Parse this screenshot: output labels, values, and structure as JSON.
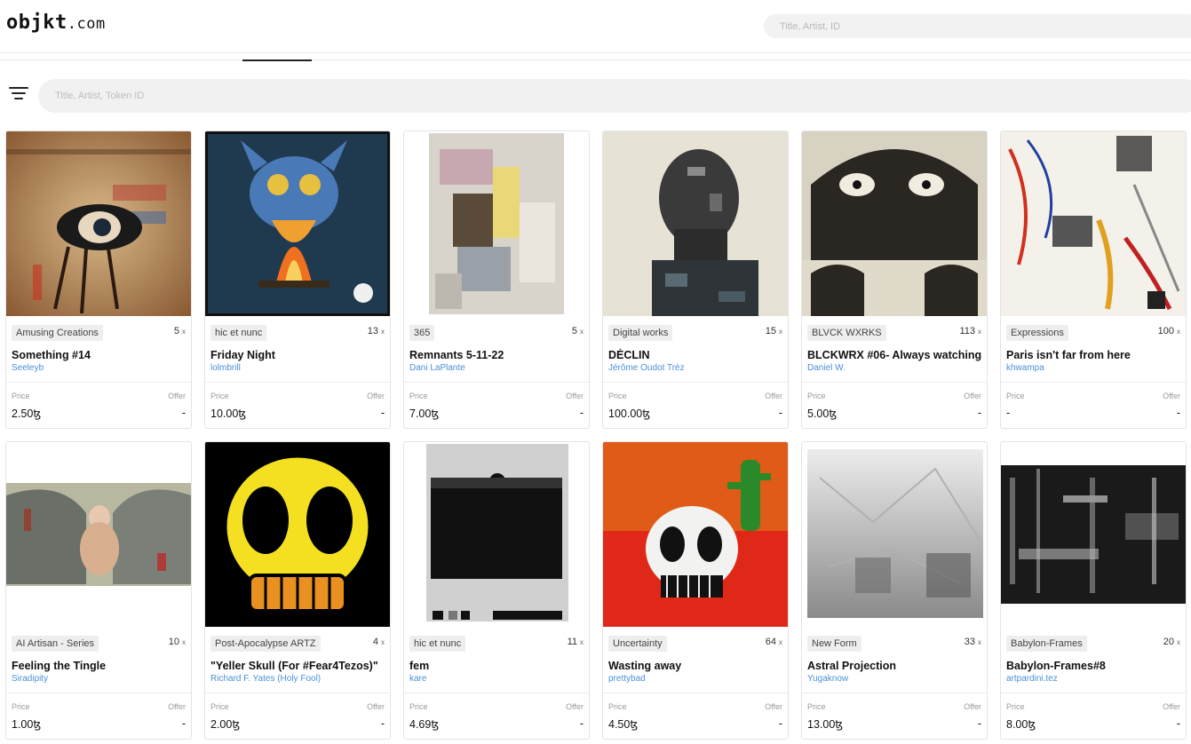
{
  "header": {
    "logo_main": "objkt",
    "logo_suffix": ".com",
    "search_placeholder": "Title, Artist, ID"
  },
  "toolbar": {
    "search_placeholder": "Title, Artist, Token ID"
  },
  "labels": {
    "price": "Price",
    "offer": "Offer",
    "editions_suffix": "x"
  },
  "cards": [
    {
      "collection": "Amusing Creations",
      "editions": "5",
      "title": "Something #14",
      "artist": "Seeleyb",
      "price": "2.50ꜩ",
      "offer": "-"
    },
    {
      "collection": "hic et nunc",
      "editions": "13",
      "title": "Friday Night",
      "artist": "lolmbrill",
      "price": "10.00ꜩ",
      "offer": "-"
    },
    {
      "collection": "365",
      "editions": "5",
      "title": "Remnants 5-11-22",
      "artist": "Dani LaPlante",
      "price": "7.00ꜩ",
      "offer": "-"
    },
    {
      "collection": "Digital works",
      "editions": "15",
      "title": "DÉCLIN",
      "artist": "Jérôme Oudot Trèz",
      "price": "100.00ꜩ",
      "offer": "-"
    },
    {
      "collection": "BLVCK WXRKS",
      "editions": "113",
      "title": "BLCKWRX #06- Always watching",
      "artist": "Daniel W.",
      "price": "5.00ꜩ",
      "offer": "-"
    },
    {
      "collection": "Expressions",
      "editions": "100",
      "title": "Paris isn't far from here",
      "artist": "khwampa",
      "price": "-",
      "offer": "-"
    },
    {
      "collection": "AI Artisan - Series",
      "editions": "10",
      "title": "Feeling the Tingle",
      "artist": "Siradipity",
      "price": "1.00ꜩ",
      "offer": "-"
    },
    {
      "collection": "Post-Apocalypse ARTZ",
      "editions": "4",
      "title": "\"Yeller Skull (For #Fear4Tezos)\"",
      "artist": "Richard F. Yates (Holy Fool)",
      "price": "2.00ꜩ",
      "offer": "-"
    },
    {
      "collection": "hic et nunc",
      "editions": "11",
      "title": "fem",
      "artist": "kare",
      "price": "4.69ꜩ",
      "offer": "-"
    },
    {
      "collection": "Uncertainty",
      "editions": "64",
      "title": "Wasting away",
      "artist": "prettybad",
      "price": "4.50ꜩ",
      "offer": "-"
    },
    {
      "collection": "New Form",
      "editions": "33",
      "title": "Astral Projection",
      "artist": "Yugaknow",
      "price": "13.00ꜩ",
      "offer": "-"
    },
    {
      "collection": "Babylon-Frames",
      "editions": "20",
      "title": "Babylon-Frames#8",
      "artist": "artpardini.tez",
      "price": "8.00ꜩ",
      "offer": "-"
    }
  ]
}
